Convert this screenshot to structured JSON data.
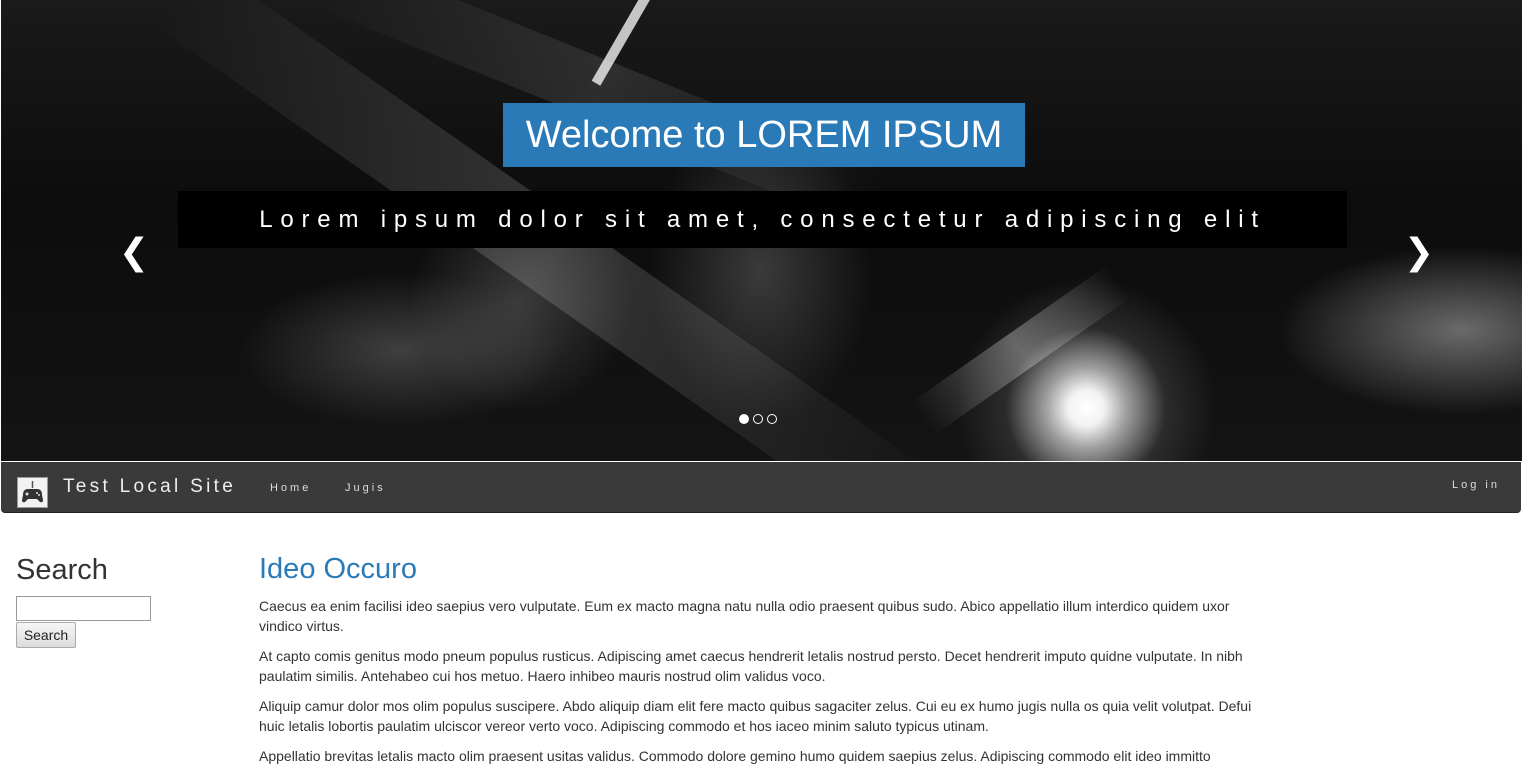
{
  "hero": {
    "title": "Welcome to LOREM IPSUM",
    "subtitle": "Lorem ipsum dolor sit amet, consectetur adipiscing elit",
    "prev_icon": "chevron-left-icon",
    "next_icon": "chevron-right-icon",
    "slides_count": 3,
    "active_slide": 1
  },
  "navbar": {
    "brand": "Test Local Site",
    "logo_icon": "gamepad-icon",
    "links": [
      "Home",
      "Jugis"
    ],
    "login": "Log in"
  },
  "sidebar": {
    "title": "Search",
    "search_value": "",
    "button_label": "Search"
  },
  "article": {
    "title": "Ideo Occuro",
    "paragraphs": [
      "Caecus ea enim facilisi ideo saepius vero vulputate. Eum ex macto magna natu nulla odio praesent quibus sudo. Abico appellatio illum interdico quidem uxor vindico virtus.",
      "At capto comis genitus modo pneum populus rusticus. Adipiscing amet caecus hendrerit letalis nostrud persto. Decet hendrerit imputo quidne vulputate. In nibh paulatim similis. Antehabeo cui hos metuo. Haero inhibeo mauris nostrud olim validus voco.",
      "Aliquip camur dolor mos olim populus suscipere. Abdo aliquip diam elit fere macto quibus sagaciter zelus. Cui eu ex humo jugis nulla os quia velit volutpat. Defui huic letalis lobortis paulatim ulciscor vereor verto voco. Adipiscing commodo et hos iaceo minim saluto typicus utinam.",
      "Appellatio brevitas letalis macto olim praesent usitas validus. Commodo dolore gemino humo quidem saepius zelus. Adipiscing commodo elit ideo immitto"
    ]
  },
  "colors": {
    "accent": "#2a7ab8",
    "navbar_bg": "#3a3a3a",
    "hero_band_bg": "#000000"
  }
}
